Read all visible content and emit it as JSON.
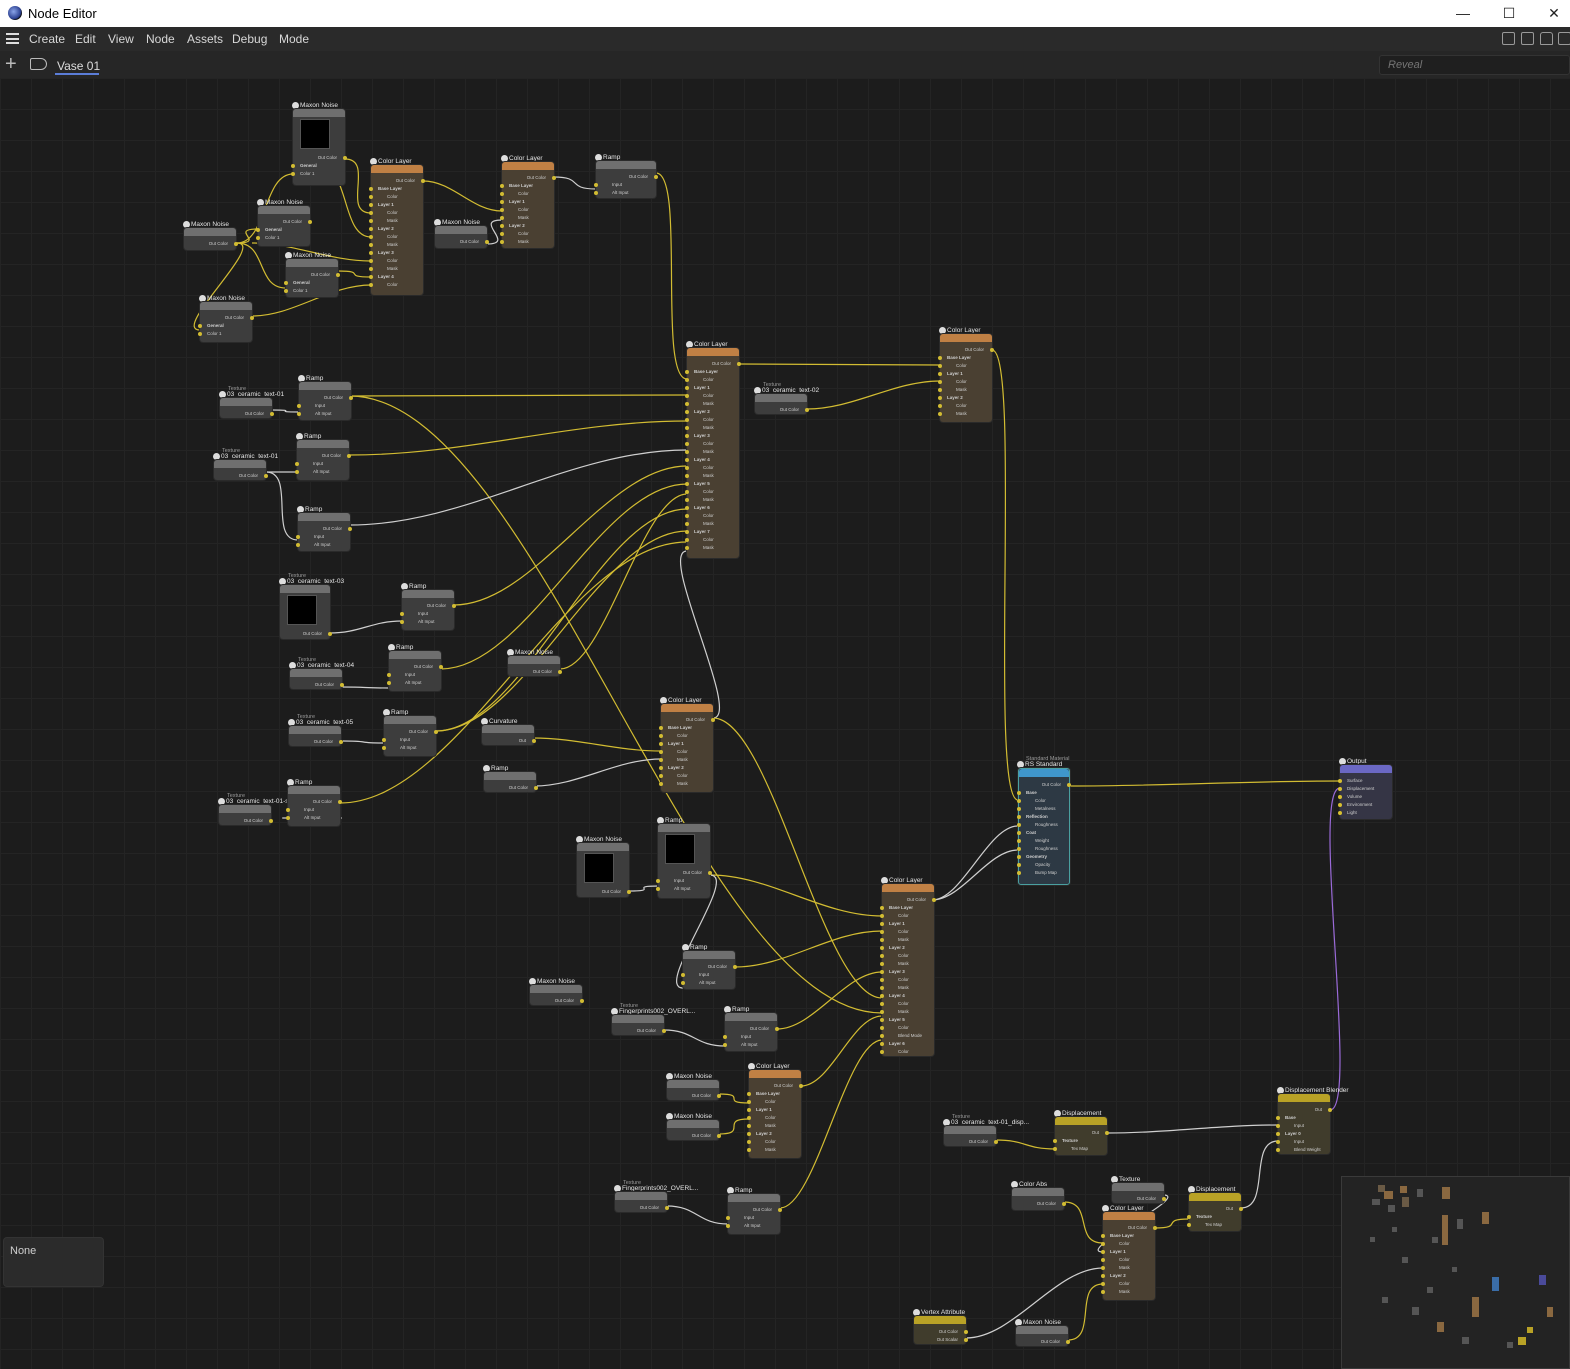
{
  "window": {
    "title": "Node Editor",
    "controls": [
      "—",
      "☐",
      "✕"
    ]
  },
  "menu": {
    "items": [
      "Create",
      "Edit",
      "View",
      "Node",
      "Assets",
      "Debug",
      "Mode"
    ]
  },
  "tabs": {
    "active": "Vase 01"
  },
  "search": {
    "placeholder": "Reveal"
  },
  "info_panel": {
    "text": "None"
  },
  "nodes": {
    "n1": {
      "title": "Maxon Noise",
      "ports": [
        "Out Color",
        "General",
        "Color 1"
      ]
    },
    "n2": {
      "title": "Color Layer",
      "ports": [
        "Out Color",
        "Base Layer",
        "Color",
        "Layer 1",
        "Color",
        "Mask",
        "Layer 2",
        "Color",
        "Mask",
        "Layer 3",
        "Color",
        "Mask",
        "Layer 4",
        "Color"
      ]
    },
    "n3": {
      "title": "Color Layer",
      "ports": [
        "Out Color",
        "Base Layer",
        "Color",
        "Layer 1",
        "Color",
        "Mask",
        "Layer 2",
        "Color",
        "Mask"
      ]
    },
    "n4": {
      "title": "Ramp",
      "ports": [
        "Out Color",
        "Input",
        "Alt Input"
      ]
    },
    "n5": {
      "title": "Maxon Noise",
      "ports": [
        "Out Color",
        "General",
        "Color 1"
      ]
    },
    "n6": {
      "title": "Maxon Noise",
      "ports": [
        "Out Color"
      ]
    },
    "n7": {
      "title": "Maxon Noise",
      "ports": [
        "Out Color"
      ]
    },
    "n8": {
      "title": "Maxon Noise",
      "ports": [
        "Out Color",
        "General",
        "Color 1"
      ]
    },
    "n9": {
      "title": "Maxon Noise",
      "ports": [
        "Out Color",
        "General",
        "Color 1"
      ]
    },
    "n10": {
      "title": "Color Layer",
      "ports": [
        "Out Color",
        "Base Layer",
        "Color",
        "Layer 1",
        "Color",
        "Mask",
        "Layer 2",
        "Color",
        "Mask",
        "Layer 3",
        "Color",
        "Mask",
        "Layer 4",
        "Color",
        "Mask",
        "Layer 5",
        "Color",
        "Mask",
        "Layer 6",
        "Color",
        "Mask",
        "Layer 7",
        "Color",
        "Mask"
      ]
    },
    "n11": {
      "title": "Color Layer",
      "ports": [
        "Out Color",
        "Base Layer",
        "Color",
        "Layer 1",
        "Color",
        "Mask",
        "Layer 2",
        "Color",
        "Mask"
      ]
    },
    "n12": {
      "sub": "Texture",
      "title": "03_ceramic_text-01",
      "ports": [
        "Out Color"
      ]
    },
    "n13": {
      "title": "Ramp",
      "ports": [
        "Out Color",
        "Input",
        "Alt Input"
      ]
    },
    "n14": {
      "sub": "Texture",
      "title": "03_ceramic_text-02",
      "ports": [
        "Out Color"
      ]
    },
    "n15": {
      "sub": "Texture",
      "title": "03_ceramic_text-01",
      "ports": [
        "Out Color"
      ]
    },
    "n16": {
      "title": "Ramp",
      "ports": [
        "Out Color",
        "Input",
        "Alt Input"
      ]
    },
    "n17": {
      "title": "Ramp",
      "ports": [
        "Out Color",
        "Input",
        "Alt Input"
      ]
    },
    "n18": {
      "sub": "Texture",
      "title": "03_ceramic_text-03",
      "ports": [
        "Out Color"
      ]
    },
    "n19": {
      "title": "Ramp",
      "ports": [
        "Out Color",
        "Input",
        "Alt Input"
      ]
    },
    "n20": {
      "sub": "Texture",
      "title": "03_ceramic_text-04",
      "ports": [
        "Out Color"
      ]
    },
    "n21": {
      "title": "Ramp",
      "ports": [
        "Out Color",
        "Input",
        "Alt Input"
      ]
    },
    "n22": {
      "title": "Maxon Noise",
      "ports": [
        "Out Color"
      ]
    },
    "n23": {
      "sub": "Texture",
      "title": "03_ceramic_text-05",
      "ports": [
        "Out Color"
      ]
    },
    "n24": {
      "title": "Ramp",
      "ports": [
        "Out Color",
        "Input",
        "Alt Input"
      ]
    },
    "n25": {
      "title": "Curvature",
      "ports": [
        "Out"
      ]
    },
    "n26": {
      "title": "Color Layer",
      "ports": [
        "Out Color",
        "Base Layer",
        "Color",
        "Layer 1",
        "Color",
        "Mask",
        "Layer 2",
        "Color",
        "Mask"
      ]
    },
    "n27": {
      "title": "Ramp",
      "ports": [
        "Out Color"
      ]
    },
    "n28": {
      "sub": "Texture",
      "title": "03_ceramic_text-01-sma",
      "ports": [
        "Out Color"
      ]
    },
    "n29": {
      "title": "Ramp",
      "ports": [
        "Out Color",
        "Input",
        "Alt Input"
      ]
    },
    "n30": {
      "title": "Maxon Noise",
      "ports": [
        "Out Color"
      ]
    },
    "n31": {
      "title": "Ramp",
      "ports": [
        "Out Color",
        "Input",
        "Alt Input"
      ]
    },
    "n32": {
      "sub": "Standard Material",
      "title": "RS Standard",
      "ports": [
        "Out Color",
        "Base",
        "Color",
        "Metalness",
        "Reflection",
        "Roughness",
        "Coat",
        "Weight",
        "Roughness",
        "Geometry",
        "Opacity",
        "Bump Map"
      ]
    },
    "n33": {
      "title": "Output",
      "ports": [
        "Surface",
        "Displacement",
        "Volume",
        "Environment",
        "Light"
      ]
    },
    "n34": {
      "title": "Color Layer",
      "ports": [
        "Out Color",
        "Base Layer",
        "Color",
        "Layer 1",
        "Color",
        "Mask",
        "Layer 2",
        "Color",
        "Mask",
        "Layer 3",
        "Color",
        "Mask",
        "Layer 4",
        "Color",
        "Mask",
        "Layer 5",
        "Color",
        "Blend Mode",
        "Layer 6",
        "Color"
      ]
    },
    "n35": {
      "title": "Ramp",
      "ports": [
        "Out Color",
        "Input",
        "Alt Input"
      ]
    },
    "n36": {
      "title": "Maxon Noise",
      "ports": [
        "Out Color"
      ]
    },
    "n37": {
      "sub": "Texture",
      "title": "Fingerprints002_OVERL...",
      "ports": [
        "Out Color"
      ]
    },
    "n38": {
      "title": "Ramp",
      "ports": [
        "Out Color",
        "Input",
        "Alt Input"
      ]
    },
    "n39": {
      "title": "Maxon Noise",
      "ports": [
        "Out Color"
      ]
    },
    "n40": {
      "title": "Color Layer",
      "ports": [
        "Out Color",
        "Base Layer",
        "Color",
        "Layer 1",
        "Color",
        "Mask",
        "Layer 2",
        "Color",
        "Mask"
      ]
    },
    "n41": {
      "title": "Maxon Noise",
      "ports": [
        "Out Color"
      ]
    },
    "n42": {
      "sub": "Texture",
      "title": "03_ceramic_text-01_disp...",
      "ports": [
        "Out Color"
      ]
    },
    "n43": {
      "title": "Displacement",
      "ports": [
        "Out",
        "Texture",
        "Tex Map"
      ]
    },
    "n44": {
      "title": "Displacement Blender",
      "ports": [
        "Out",
        "Base",
        "Input",
        "Layer 0",
        "Input",
        "Blend Weight"
      ]
    },
    "n45": {
      "sub": "Texture",
      "title": "Fingerprints002_OVERL...",
      "ports": [
        "Out Color"
      ]
    },
    "n46": {
      "title": "Ramp",
      "ports": [
        "Out Color",
        "Input",
        "Alt Input"
      ]
    },
    "n47": {
      "title": "Color Abs",
      "ports": [
        "Out Color",
        "Input"
      ]
    },
    "n48": {
      "title": "Texture",
      "ports": [
        "Out Color"
      ]
    },
    "n49": {
      "title": "Displacement",
      "ports": [
        "Out",
        "Texture",
        "Tex Map"
      ]
    },
    "n50": {
      "title": "Color Layer",
      "ports": [
        "Out Color",
        "Base Layer",
        "Color",
        "Layer 1",
        "Color",
        "Mask",
        "Layer 2",
        "Color",
        "Mask"
      ]
    },
    "n51": {
      "title": "Vertex Attribute",
      "ports": [
        "Out Color",
        "Out Scalar"
      ]
    },
    "n52": {
      "title": "Maxon Noise",
      "ports": [
        "Out Color"
      ]
    }
  },
  "colors": {
    "wire_color": "#d2bc32",
    "wire_alt": "#cfcfcf",
    "wire_displacement": "#9a6ad8",
    "color_layer_header": "#c08044",
    "material_header": "#3f96cc",
    "output_header": "#6b68c4",
    "displacement_header": "#b9a226"
  }
}
